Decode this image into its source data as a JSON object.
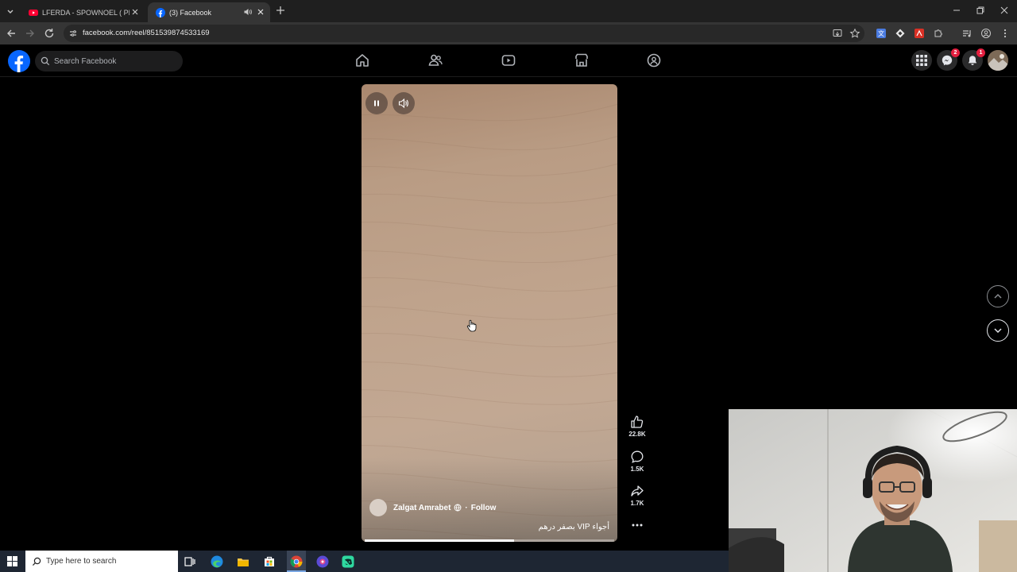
{
  "browser": {
    "tabs": [
      {
        "title": "LFERDA - SPOWNOEL ( PROD BY ...",
        "favicon": "youtube-icon",
        "active": false
      },
      {
        "title": "(3) Facebook",
        "favicon": "facebook-icon",
        "active": true,
        "audio": "speaker-icon"
      }
    ],
    "url": "facebook.com/reel/851539874533169"
  },
  "facebook": {
    "search_placeholder": "Search Facebook",
    "nav_icons": [
      "home-icon",
      "friends-icon",
      "watch-icon",
      "marketplace-icon",
      "groups-icon"
    ],
    "messenger_badge": "2",
    "notifications_badge": "1",
    "colors": {
      "brand": "#0866ff",
      "badge": "#e41e3f"
    }
  },
  "reel": {
    "author": "Zalgat Amrabet",
    "separator": "·",
    "follow_label": "Follow",
    "caption": "أجواء VIP بصفر درهم",
    "progress": 0.6,
    "likes": "22.8K",
    "comments": "1.5K",
    "shares": "1.7K"
  },
  "taskbar": {
    "search_placeholder": "Type here to search",
    "apps": [
      "task-view-icon",
      "edge-icon",
      "file-explorer-icon",
      "store-icon",
      "chrome-icon",
      "app-icon",
      "discord-icon"
    ]
  }
}
